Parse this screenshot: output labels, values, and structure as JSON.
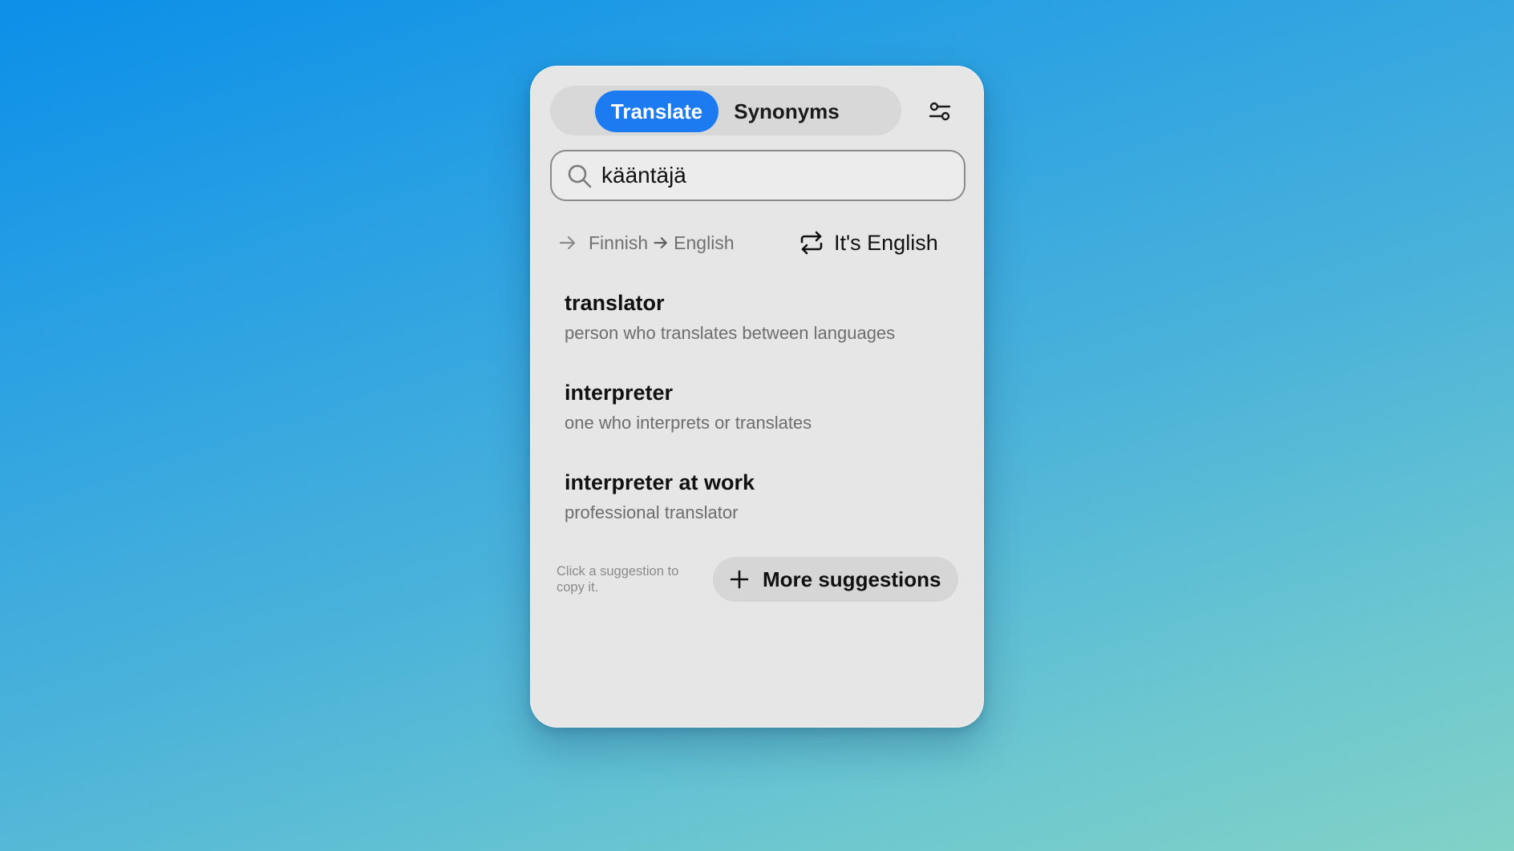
{
  "tabs": {
    "translate_label": "Translate",
    "synonyms_label": "Synonyms",
    "active": "Translate"
  },
  "search": {
    "value": "kääntäjä",
    "placeholder": ""
  },
  "language": {
    "source": "Finnish",
    "target": "English",
    "swap_label": "It's English"
  },
  "suggestions": [
    {
      "word": "translator",
      "description": "person who translates between languages"
    },
    {
      "word": "interpreter",
      "description": "one who interprets or translates"
    },
    {
      "word": "interpreter at work",
      "description": "professional translator"
    }
  ],
  "footer": {
    "hint": "Click a suggestion to copy it.",
    "more_label": "More suggestions"
  },
  "icons": {
    "settings": "sliders-icon",
    "search": "search-icon",
    "direction": "arrow-right-icon",
    "swap": "swap-icon",
    "more": "plus-icon"
  },
  "colors": {
    "accent": "#1d7bf2",
    "panel": "#e6e6e6",
    "background_top": "#0b8fe8",
    "background_bottom": "#82d2c6"
  }
}
